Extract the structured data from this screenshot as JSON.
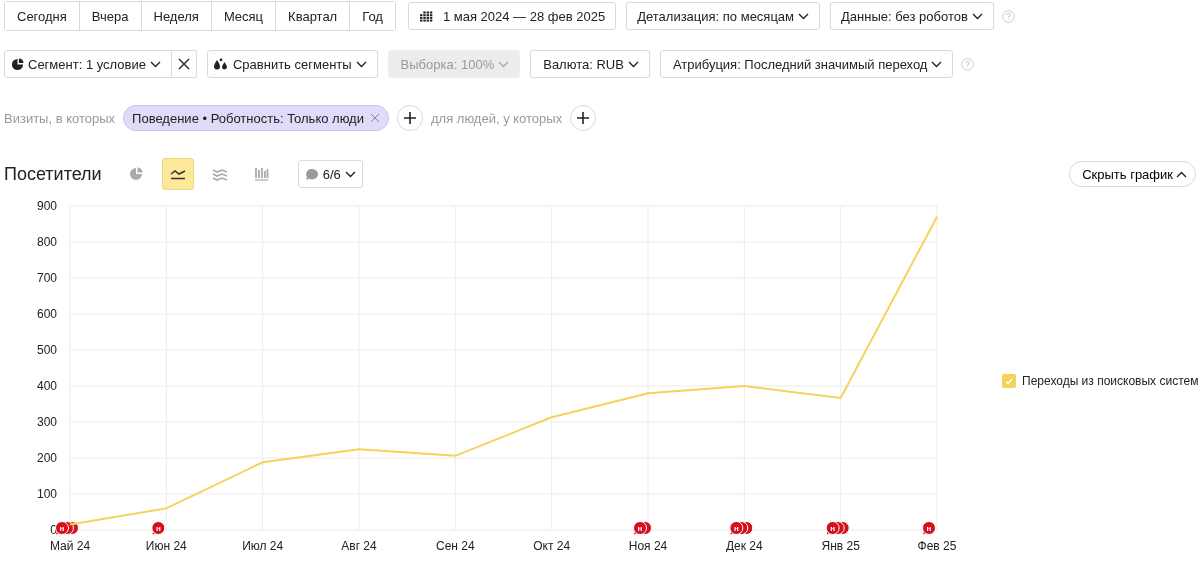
{
  "periods": [
    {
      "label": "Сегодня",
      "selected": false
    },
    {
      "label": "Вчера",
      "selected": false
    },
    {
      "label": "Неделя",
      "selected": false
    },
    {
      "label": "Месяц",
      "selected": false
    },
    {
      "label": "Квартал",
      "selected": false
    },
    {
      "label": "Год",
      "selected": false
    }
  ],
  "date_range": "1 мая 2024 — 28 фев 2025",
  "row1_dropdowns": [
    {
      "label": "Детализация: по месяцам",
      "disabled": false
    },
    {
      "label": "Данные: без роботов",
      "disabled": false
    }
  ],
  "segment": {
    "label": "Сегмент: 1 условие"
  },
  "row2_dropdowns": [
    {
      "kind": "compare",
      "label": "Сравнить сегменты",
      "disabled": false
    },
    {
      "kind": "plain",
      "label": "Выборка: 100%",
      "disabled": true
    },
    {
      "kind": "plain",
      "label": "Валюта: RUB",
      "disabled": false
    },
    {
      "kind": "plain",
      "label": "Атрибуция: Последний значимый переход",
      "disabled": false
    }
  ],
  "filters": {
    "visits_label": "Визиты, в которых",
    "chip": "Поведение • Роботность: Только люди",
    "people_label": "для людей, у которых"
  },
  "report": {
    "title": "Посетители",
    "chart_types": [
      {
        "kind": "pie",
        "selected": false
      },
      {
        "kind": "line",
        "selected": true
      },
      {
        "kind": "area",
        "selected": false
      },
      {
        "kind": "bars",
        "selected": false
      }
    ],
    "notes": "6/6",
    "hide_button": "Скрыть график"
  },
  "chart_data": {
    "type": "line",
    "categories": [
      "Май 24",
      "Июн 24",
      "Июл 24",
      "Авг 24",
      "Сен 24",
      "Окт 24",
      "Ноя 24",
      "Дек 24",
      "Янв 25",
      "Фев 25"
    ],
    "series": [
      {
        "color": "#f5d25a",
        "values": [
          15,
          60,
          188,
          224,
          206,
          313,
          380,
          400,
          367,
          870
        ]
      }
    ],
    "ylim": [
      0,
      900
    ],
    "yticks": [
      0,
      100,
      200,
      300,
      400,
      500,
      600,
      700,
      800,
      900
    ],
    "grid": true
  },
  "note_markers": [
    {
      "kind": "note",
      "label": "н",
      "behind": [
        {
          "kind": "note"
        },
        {
          "kind": "note"
        }
      ]
    },
    {
      "kind": "note",
      "label": "н"
    },
    {
      "kind": "none"
    },
    {
      "kind": "none"
    },
    {
      "kind": "none"
    },
    {
      "kind": "none"
    },
    {
      "kind": "note",
      "label": "н",
      "behind": [
        {
          "kind": "note"
        }
      ]
    },
    {
      "kind": "note",
      "label": "н",
      "behind": [
        {
          "kind": "note"
        },
        {
          "kind": "note"
        }
      ]
    },
    {
      "kind": "note",
      "label": "н",
      "behind": [
        {
          "kind": "note"
        },
        {
          "kind": "note"
        }
      ]
    },
    {
      "kind": "note",
      "label": "н"
    }
  ],
  "legend": [
    {
      "label": "Переходы из поисковых систем",
      "checked": true
    }
  ]
}
